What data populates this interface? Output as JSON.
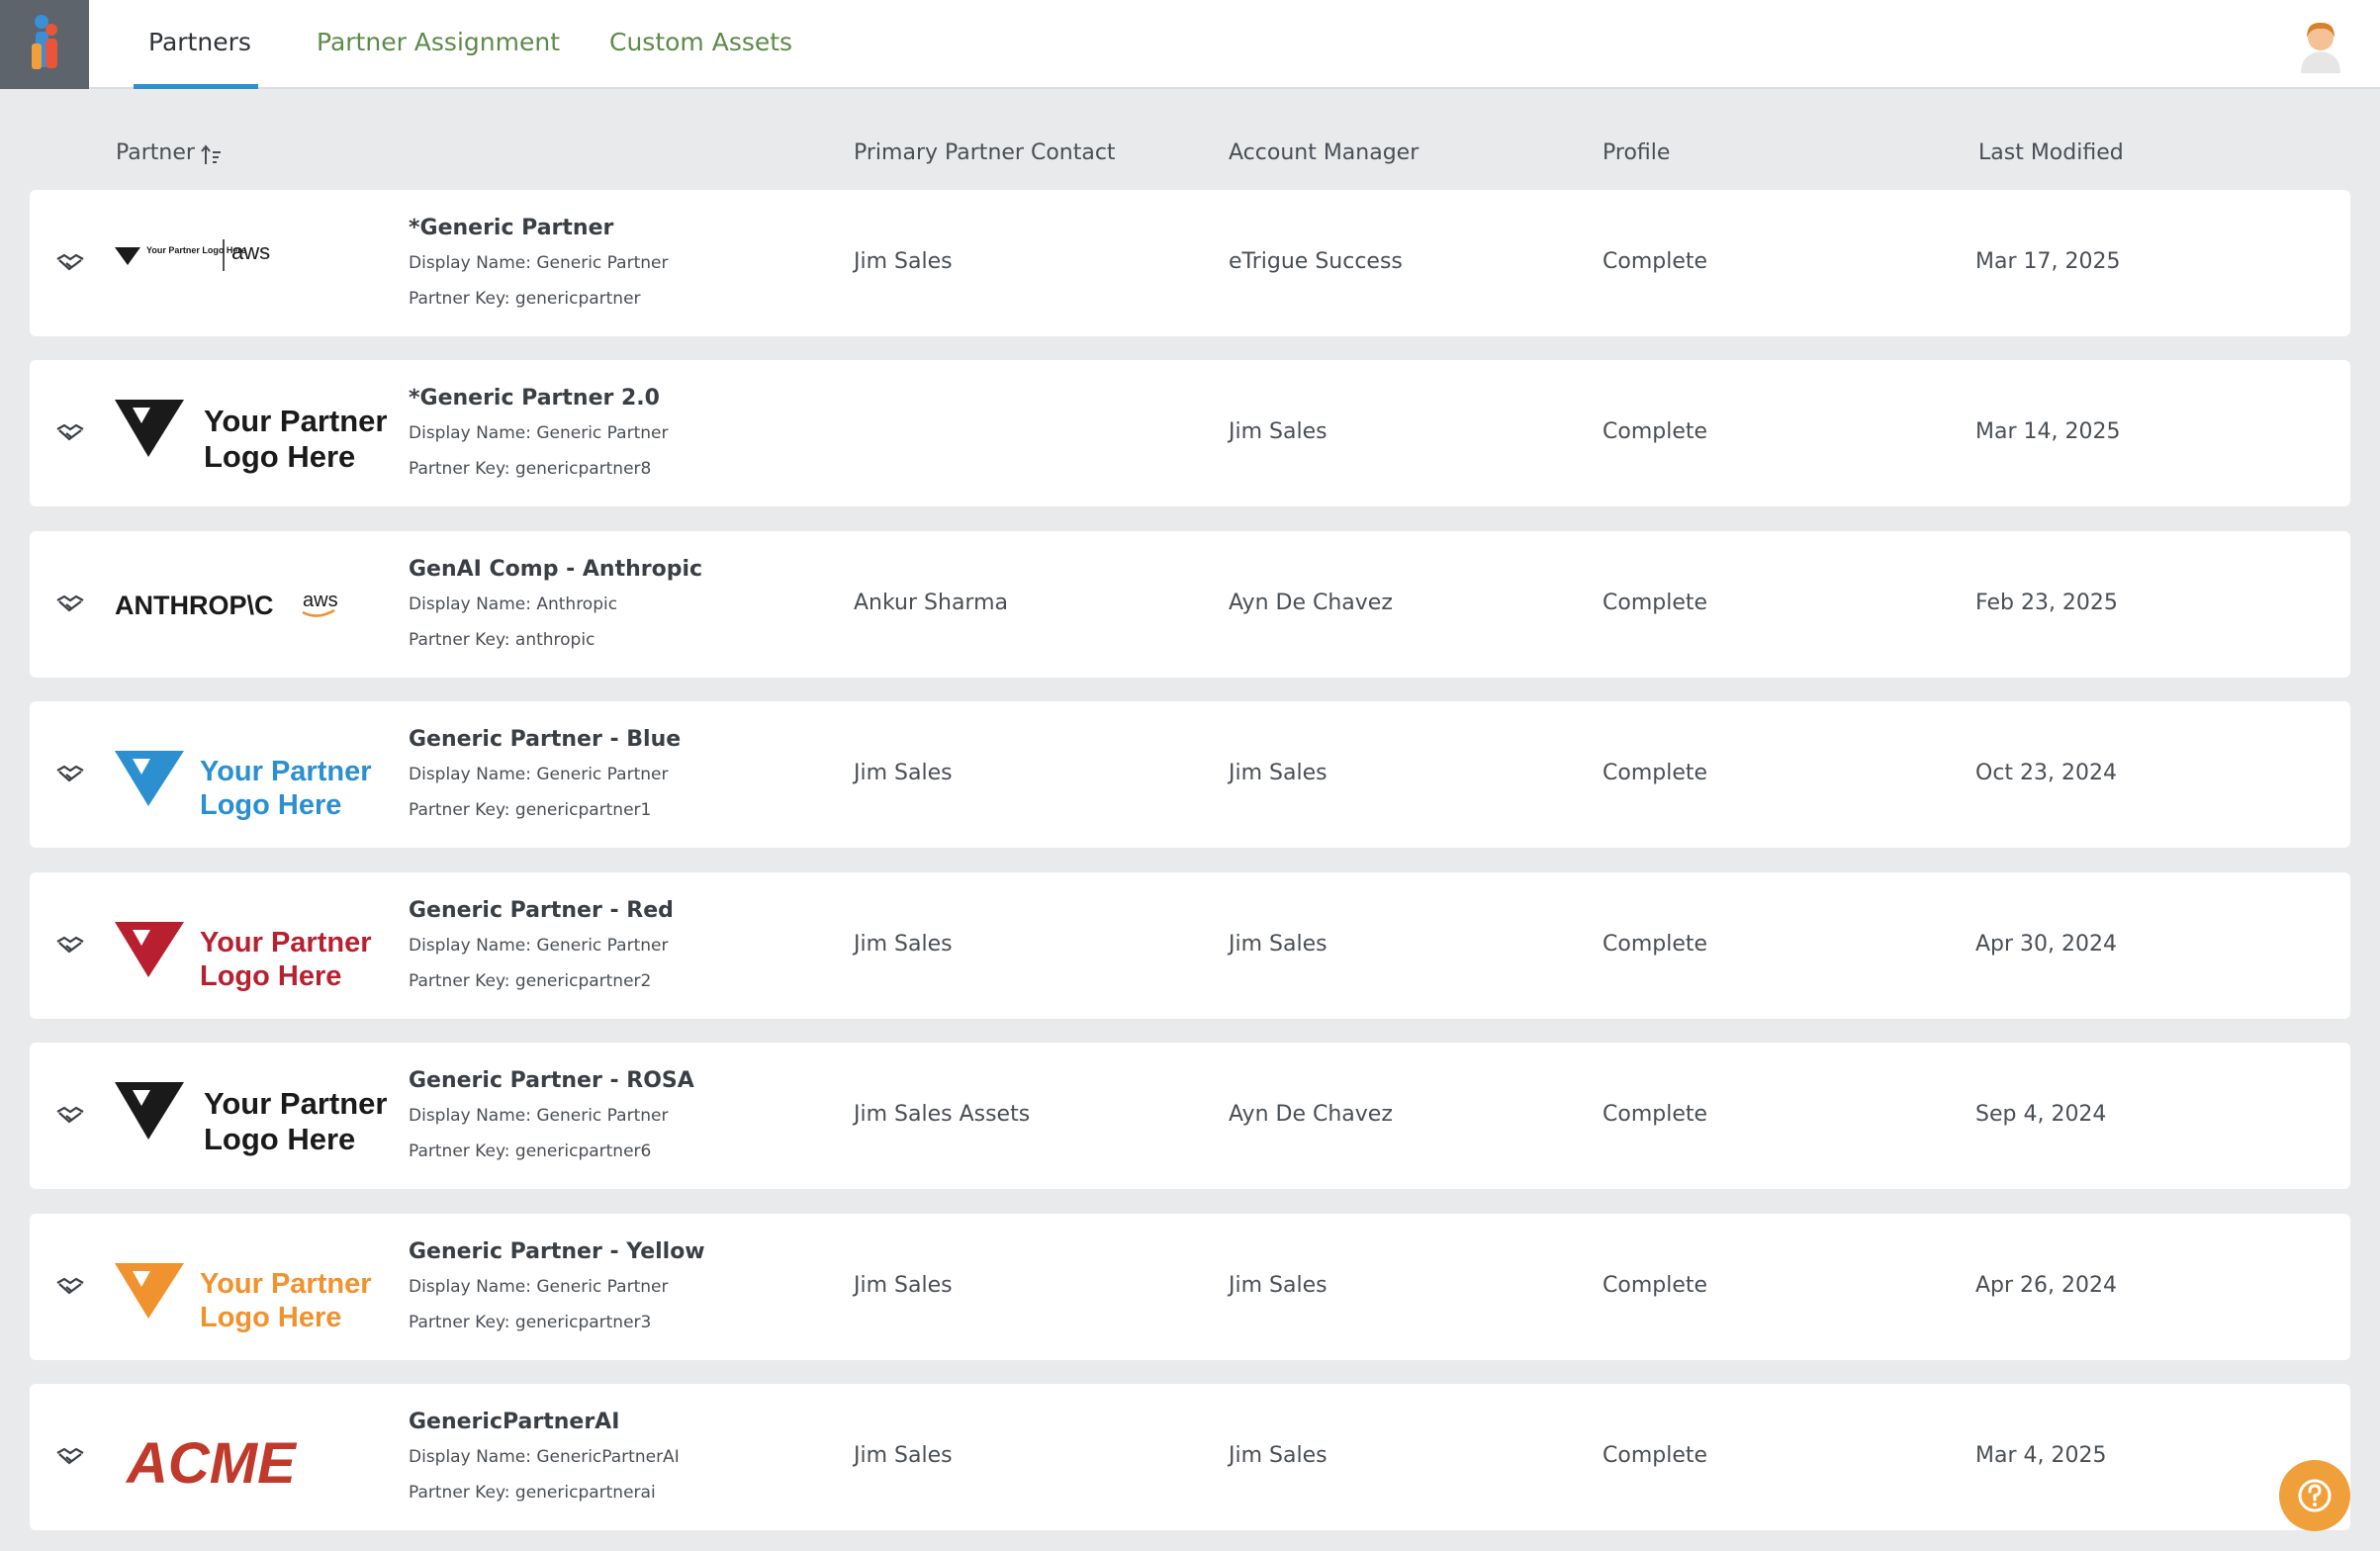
{
  "nav": {
    "tabs": [
      {
        "label": "Partners"
      },
      {
        "label": "Partner Assignment"
      },
      {
        "label": "Custom Assets"
      }
    ],
    "accent_color": "#2c90d2"
  },
  "table": {
    "headers": {
      "partner": "Partner",
      "contact": "Primary Partner Contact",
      "manager": "Account Manager",
      "profile": "Profile",
      "modified": "Last Modified"
    },
    "rows": [
      {
        "name": "*Generic Partner",
        "display": "Display Name: Generic Partner",
        "key": "Partner Key: genericpartner",
        "contact": "Jim Sales",
        "manager": "eTrigue Success",
        "profile": "Complete",
        "modified": "Mar 17, 2025",
        "logo_text": "Your Partner Logo Here",
        "logo_text2": "aws",
        "logo_color": "#1a1a1a"
      },
      {
        "name": "*Generic Partner 2.0",
        "display": "Display Name: Generic Partner",
        "key": "Partner Key: genericpartner8",
        "contact": "",
        "manager": "Jim Sales",
        "profile": "Complete",
        "modified": "Mar 14, 2025",
        "logo_text": "Your Partner",
        "logo_text2": "Logo Here",
        "logo_color": "#1a1a1a"
      },
      {
        "name": "GenAI Comp - Anthropic",
        "display": "Display Name: Anthropic",
        "key": "Partner Key: anthropic",
        "contact": "Ankur Sharma",
        "manager": "Ayn De Chavez",
        "profile": "Complete",
        "modified": "Feb 23, 2025",
        "logo_text": "ANTHROP\\C",
        "logo_text2": "aws",
        "logo_color": "#1a1a1a"
      },
      {
        "name": "Generic Partner - Blue",
        "display": "Display Name: Generic Partner",
        "key": "Partner Key: genericpartner1",
        "contact": "Jim Sales",
        "manager": "Jim Sales",
        "profile": "Complete",
        "modified": "Oct 23, 2024",
        "logo_text": "Your Partner",
        "logo_text2": "Logo Here",
        "logo_color": "#2b8fd0"
      },
      {
        "name": "Generic Partner - Red",
        "display": "Display Name: Generic Partner",
        "key": "Partner Key: genericpartner2",
        "contact": "Jim Sales",
        "manager": "Jim Sales",
        "profile": "Complete",
        "modified": "Apr 30, 2024",
        "logo_text": "Your Partner",
        "logo_text2": "Logo Here",
        "logo_color": "#b8202f"
      },
      {
        "name": "Generic Partner - ROSA",
        "display": "Display Name: Generic Partner",
        "key": "Partner Key: genericpartner6",
        "contact": "Jim Sales Assets",
        "manager": "Ayn De Chavez",
        "profile": "Complete",
        "modified": "Sep 4, 2024",
        "logo_text": "Your Partner",
        "logo_text2": "Logo Here",
        "logo_color": "#1a1a1a"
      },
      {
        "name": "Generic Partner - Yellow",
        "display": "Display Name: Generic Partner",
        "key": "Partner Key: genericpartner3",
        "contact": "Jim Sales",
        "manager": "Jim Sales",
        "profile": "Complete",
        "modified": "Apr 26, 2024",
        "logo_text": "Your Partner",
        "logo_text2": "Logo Here",
        "logo_color": "#f0922e"
      },
      {
        "name": "GenericPartnerAI",
        "display": "Display Name: GenericPartnerAI",
        "key": "Partner Key: genericpartnerai",
        "contact": "Jim Sales",
        "manager": "Jim Sales",
        "profile": "Complete",
        "modified": "Mar 4, 2025",
        "logo_text": "ACME",
        "logo_text2": "",
        "logo_color": "#c0392b"
      }
    ]
  },
  "icons": {
    "app": "app-logo-icon",
    "avatar": "user-avatar-icon",
    "sort": "sort-ascending-icon",
    "row": "handshake-icon",
    "help": "help-icon"
  }
}
